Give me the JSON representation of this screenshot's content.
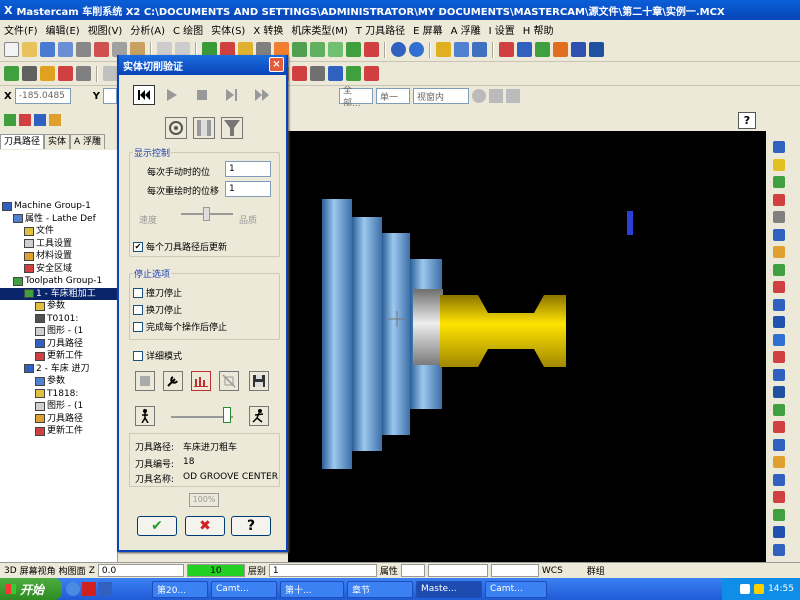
{
  "window": {
    "title": "Mastercam 车削系统  X2  C:\\DOCUMENTS AND SETTINGS\\ADMINISTRATOR\\MY DOCUMENTS\\MASTERCAM\\源文件\\第二十章\\实例一.MCX",
    "logo": "X"
  },
  "menu": [
    "文件(F)",
    "编辑(E)",
    "视图(V)",
    "分析(A)",
    "C 绘图",
    "实体(S)",
    "X 转换",
    "机床类型(M)",
    "T 刀具路径",
    "E 屏幕",
    "A 浮雕",
    "I 设置",
    "H 帮助"
  ],
  "coordbar": {
    "x_label": "X",
    "x_value": "-185.0485",
    "y_label": "Y",
    "select_all": "全部...",
    "select_single": "单一",
    "view_mode": "视窗内"
  },
  "left_panel": {
    "tabs": [
      "刀具路径",
      "实体",
      "A 浮雕"
    ],
    "tree": [
      {
        "label": "Machine Group-1",
        "indent": 0
      },
      {
        "label": "属性 - Lathe Def",
        "indent": 1
      },
      {
        "label": "文件",
        "indent": 2
      },
      {
        "label": "工具设置",
        "indent": 2
      },
      {
        "label": "材料设置",
        "indent": 2
      },
      {
        "label": "安全区域",
        "indent": 2
      },
      {
        "label": "Toolpath Group-1",
        "indent": 1
      },
      {
        "label": "1 - 车床粗加工",
        "indent": 2,
        "selected": true
      },
      {
        "label": "参数",
        "indent": 3
      },
      {
        "label": "T0101: ",
        "indent": 3
      },
      {
        "label": "图形 - (1",
        "indent": 3
      },
      {
        "label": "刀具路径",
        "indent": 3
      },
      {
        "label": "更新工件",
        "indent": 3
      },
      {
        "label": "2 - 车床 进刀",
        "indent": 2
      },
      {
        "label": "参数",
        "indent": 3
      },
      {
        "label": "T1818: ",
        "indent": 3
      },
      {
        "label": "图形 - (1",
        "indent": 3
      },
      {
        "label": "刀具路径",
        "indent": 3
      },
      {
        "label": "更新工件",
        "indent": 3
      }
    ]
  },
  "dialog": {
    "title": "实体切削验证",
    "close": "×",
    "display_group": "显示控制",
    "manual_step_label": "每次手动时的位",
    "manual_step_value": "1",
    "redraw_step_label": "每次重绘时的位移",
    "redraw_step_value": "1",
    "speed_label": "速度",
    "quality_label": "品质",
    "update_each_label": "每个刀具路径后更新",
    "update_each_checked": true,
    "stop_group": "停止选项",
    "stop_collision": "撞刀停止",
    "stop_tool_change": "换刀停止",
    "stop_after_op": "完成每个操作后停止",
    "verbose_mode": "详细模式",
    "info": {
      "toolpath_label": "刀具路径:",
      "toolpath_value": "车床进刀粗车",
      "tool_no_label": "刀具编号:",
      "tool_no_value": "18",
      "tool_name_label": "刀具名称:",
      "tool_name_value": "OD GROOVE CENTER"
    },
    "progress": "100%",
    "ok": "✔",
    "cancel": "✖",
    "help": "?"
  },
  "statusbar": {
    "view3d": "3D",
    "screen_view": "屏幕视角",
    "plane": "构图面",
    "z_label": "Z",
    "z_value": "0.0",
    "level_value": "10",
    "level_label": "层别",
    "level_field": "1",
    "attr": "属性",
    "wcs": "WCS",
    "group": "群组"
  },
  "taskbar": {
    "start": "开始",
    "items": [
      "第20...",
      "Camt...",
      "第十...",
      "章节",
      "Maste...",
      "Camt..."
    ],
    "active_index": 4,
    "clock": "14:55"
  },
  "colors": {
    "viewport_bg": "#000000",
    "stock_blue": "#5c9ed6",
    "groove_yellow": "#f1d200",
    "xp_blue": "#0845b8"
  }
}
